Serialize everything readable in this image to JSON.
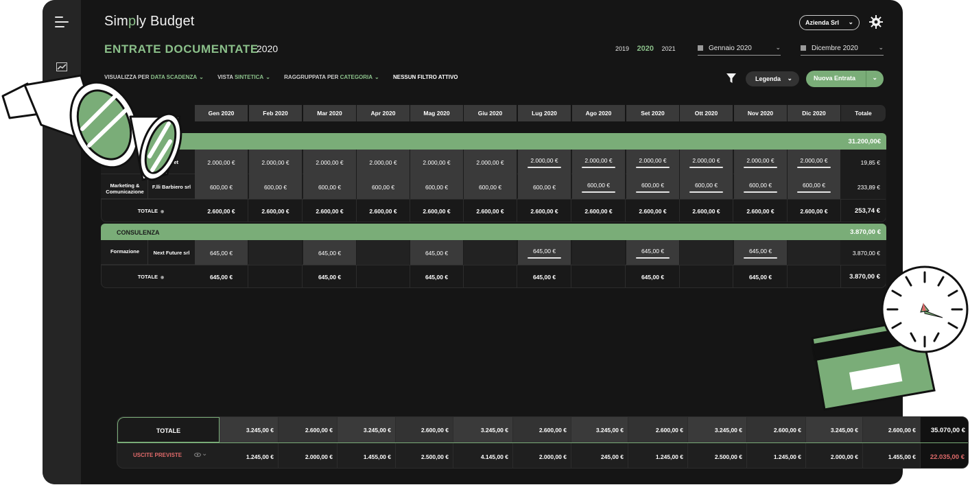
{
  "app": {
    "logo_pre": "Sim",
    "logo_p": "p",
    "logo_post": "ly Budget"
  },
  "header": {
    "company": "Azienda Srl",
    "title": "ENTRATE DOCUMENTATE",
    "year": "2020"
  },
  "years": {
    "prev": "2019",
    "current": "2020",
    "next": "2021"
  },
  "date_from": "Gennaio 2020",
  "date_to": "Dicembre 2020",
  "filters": {
    "view_by_label": "VISUALIZZA PER",
    "view_by_value": "DATA SCADENZA",
    "view_label": "VISTA",
    "view_value": "SINTETICA",
    "group_label": "RAGGRUPPATA PER",
    "group_value": "CATEGORIA",
    "no_filter": "NESSUN FILTRO ATTIVO"
  },
  "buttons": {
    "legend": "Legenda",
    "new_entry": "Nuova Entrata"
  },
  "months": [
    "Gen 2020",
    "Feb 2020",
    "Mar 2020",
    "Apr 2020",
    "Mag 2020",
    "Giu 2020",
    "Lug 2020",
    "Ago 2020",
    "Set 2020",
    "Ott 2020",
    "Nov 2020",
    "Dic 2020"
  ],
  "total_header": "Totale",
  "categories": [
    {
      "name": "",
      "total": "31.200,00€",
      "rows": [
        {
          "sub": "",
          "client": "Labet",
          "values": [
            "2.000,00 €",
            "2.000,00 €",
            "2.000,00 €",
            "2.000,00 €",
            "2.000,00 €",
            "2.000,00 €",
            "2.000,00 €",
            "2.000,00 €",
            "2.000,00 €",
            "2.000,00 €",
            "2.000,00 €",
            "2.000,00 €"
          ],
          "underlined_from": 6,
          "total": "19,85 €"
        },
        {
          "sub": "Marketing & Comunicazione",
          "client": "F.lli Barbiero srl",
          "values": [
            "600,00 €",
            "600,00 €",
            "600,00 €",
            "600,00 €",
            "600,00 €",
            "600,00 €",
            "600,00 €",
            "600,00 €",
            "600,00 €",
            "600,00 €",
            "600,00 €",
            "600,00 €"
          ],
          "underlined_from": 7,
          "total": "233,89 €"
        }
      ],
      "totals_label": "TOTALE",
      "totals": [
        "2.600,00 €",
        "2.600,00 €",
        "2.600,00 €",
        "2.600,00 €",
        "2.600,00 €",
        "2.600,00 €",
        "2.600,00 €",
        "2.600,00 €",
        "2.600,00 €",
        "2.600,00 €",
        "2.600,00 €",
        "2.600,00 €"
      ],
      "grand": "253,74 €"
    },
    {
      "name": "CONSULENZA",
      "total": "3.870,00 €",
      "rows": [
        {
          "sub": "Formazione",
          "client": "Next Future srl",
          "values": [
            "645,00 €",
            "",
            "645,00 €",
            "",
            "645,00 €",
            "",
            "645,00 €",
            "",
            "645,00 €",
            "",
            "645,00 €",
            ""
          ],
          "underlined": [
            6,
            8,
            10
          ],
          "total": "3.870,00 €"
        }
      ],
      "totals_label": "TOTALE",
      "totals": [
        "645,00 €",
        "",
        "645,00 €",
        "",
        "645,00 €",
        "",
        "645,00 €",
        "",
        "645,00 €",
        "",
        "645,00 €",
        ""
      ],
      "grand": "3.870,00 €"
    }
  ],
  "summary": {
    "total_label": "TOTALE",
    "total_values": [
      "3.245,00 €",
      "2.600,00 €",
      "3.245,00 €",
      "2.600,00 €",
      "3.245,00 €",
      "2.600,00 €",
      "3.245,00 €",
      "2.600,00 €",
      "3.245,00 €",
      "2.600,00 €",
      "3.245,00 €",
      "2.600,00 €"
    ],
    "total_grand": "35.070,00 €",
    "out_label": "USCITE PREVISTE",
    "out_values": [
      "1.245,00 €",
      "2.000,00 €",
      "1.455,00 €",
      "2.500,00 €",
      "4.145,00 €",
      "2.000,00 €",
      "245,00 €",
      "1.245,00 €",
      "2.500,00 €",
      "1.245,00 €",
      "2.000,00 €",
      "1.455,00 €"
    ],
    "out_grand": "22.035,00 €"
  },
  "colors": {
    "accent": "#7aad78",
    "negative": "#e06a6a",
    "bg": "#151515"
  }
}
